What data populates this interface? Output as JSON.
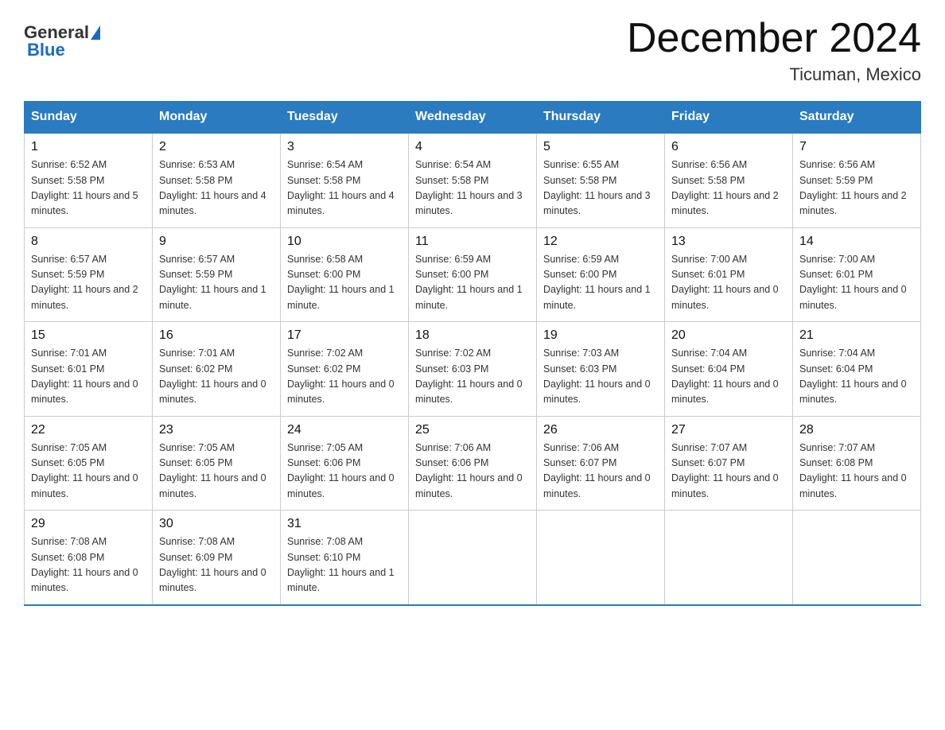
{
  "header": {
    "logo": {
      "general": "General",
      "blue": "Blue"
    },
    "title": "December 2024",
    "location": "Ticuman, Mexico"
  },
  "days": [
    "Sunday",
    "Monday",
    "Tuesday",
    "Wednesday",
    "Thursday",
    "Friday",
    "Saturday"
  ],
  "weeks": [
    [
      {
        "day": "1",
        "sunrise": "6:52 AM",
        "sunset": "5:58 PM",
        "daylight": "11 hours and 5 minutes."
      },
      {
        "day": "2",
        "sunrise": "6:53 AM",
        "sunset": "5:58 PM",
        "daylight": "11 hours and 4 minutes."
      },
      {
        "day": "3",
        "sunrise": "6:54 AM",
        "sunset": "5:58 PM",
        "daylight": "11 hours and 4 minutes."
      },
      {
        "day": "4",
        "sunrise": "6:54 AM",
        "sunset": "5:58 PM",
        "daylight": "11 hours and 3 minutes."
      },
      {
        "day": "5",
        "sunrise": "6:55 AM",
        "sunset": "5:58 PM",
        "daylight": "11 hours and 3 minutes."
      },
      {
        "day": "6",
        "sunrise": "6:56 AM",
        "sunset": "5:58 PM",
        "daylight": "11 hours and 2 minutes."
      },
      {
        "day": "7",
        "sunrise": "6:56 AM",
        "sunset": "5:59 PM",
        "daylight": "11 hours and 2 minutes."
      }
    ],
    [
      {
        "day": "8",
        "sunrise": "6:57 AM",
        "sunset": "5:59 PM",
        "daylight": "11 hours and 2 minutes."
      },
      {
        "day": "9",
        "sunrise": "6:57 AM",
        "sunset": "5:59 PM",
        "daylight": "11 hours and 1 minute."
      },
      {
        "day": "10",
        "sunrise": "6:58 AM",
        "sunset": "6:00 PM",
        "daylight": "11 hours and 1 minute."
      },
      {
        "day": "11",
        "sunrise": "6:59 AM",
        "sunset": "6:00 PM",
        "daylight": "11 hours and 1 minute."
      },
      {
        "day": "12",
        "sunrise": "6:59 AM",
        "sunset": "6:00 PM",
        "daylight": "11 hours and 1 minute."
      },
      {
        "day": "13",
        "sunrise": "7:00 AM",
        "sunset": "6:01 PM",
        "daylight": "11 hours and 0 minutes."
      },
      {
        "day": "14",
        "sunrise": "7:00 AM",
        "sunset": "6:01 PM",
        "daylight": "11 hours and 0 minutes."
      }
    ],
    [
      {
        "day": "15",
        "sunrise": "7:01 AM",
        "sunset": "6:01 PM",
        "daylight": "11 hours and 0 minutes."
      },
      {
        "day": "16",
        "sunrise": "7:01 AM",
        "sunset": "6:02 PM",
        "daylight": "11 hours and 0 minutes."
      },
      {
        "day": "17",
        "sunrise": "7:02 AM",
        "sunset": "6:02 PM",
        "daylight": "11 hours and 0 minutes."
      },
      {
        "day": "18",
        "sunrise": "7:02 AM",
        "sunset": "6:03 PM",
        "daylight": "11 hours and 0 minutes."
      },
      {
        "day": "19",
        "sunrise": "7:03 AM",
        "sunset": "6:03 PM",
        "daylight": "11 hours and 0 minutes."
      },
      {
        "day": "20",
        "sunrise": "7:04 AM",
        "sunset": "6:04 PM",
        "daylight": "11 hours and 0 minutes."
      },
      {
        "day": "21",
        "sunrise": "7:04 AM",
        "sunset": "6:04 PM",
        "daylight": "11 hours and 0 minutes."
      }
    ],
    [
      {
        "day": "22",
        "sunrise": "7:05 AM",
        "sunset": "6:05 PM",
        "daylight": "11 hours and 0 minutes."
      },
      {
        "day": "23",
        "sunrise": "7:05 AM",
        "sunset": "6:05 PM",
        "daylight": "11 hours and 0 minutes."
      },
      {
        "day": "24",
        "sunrise": "7:05 AM",
        "sunset": "6:06 PM",
        "daylight": "11 hours and 0 minutes."
      },
      {
        "day": "25",
        "sunrise": "7:06 AM",
        "sunset": "6:06 PM",
        "daylight": "11 hours and 0 minutes."
      },
      {
        "day": "26",
        "sunrise": "7:06 AM",
        "sunset": "6:07 PM",
        "daylight": "11 hours and 0 minutes."
      },
      {
        "day": "27",
        "sunrise": "7:07 AM",
        "sunset": "6:07 PM",
        "daylight": "11 hours and 0 minutes."
      },
      {
        "day": "28",
        "sunrise": "7:07 AM",
        "sunset": "6:08 PM",
        "daylight": "11 hours and 0 minutes."
      }
    ],
    [
      {
        "day": "29",
        "sunrise": "7:08 AM",
        "sunset": "6:08 PM",
        "daylight": "11 hours and 0 minutes."
      },
      {
        "day": "30",
        "sunrise": "7:08 AM",
        "sunset": "6:09 PM",
        "daylight": "11 hours and 0 minutes."
      },
      {
        "day": "31",
        "sunrise": "7:08 AM",
        "sunset": "6:10 PM",
        "daylight": "11 hours and 1 minute."
      },
      null,
      null,
      null,
      null
    ]
  ]
}
